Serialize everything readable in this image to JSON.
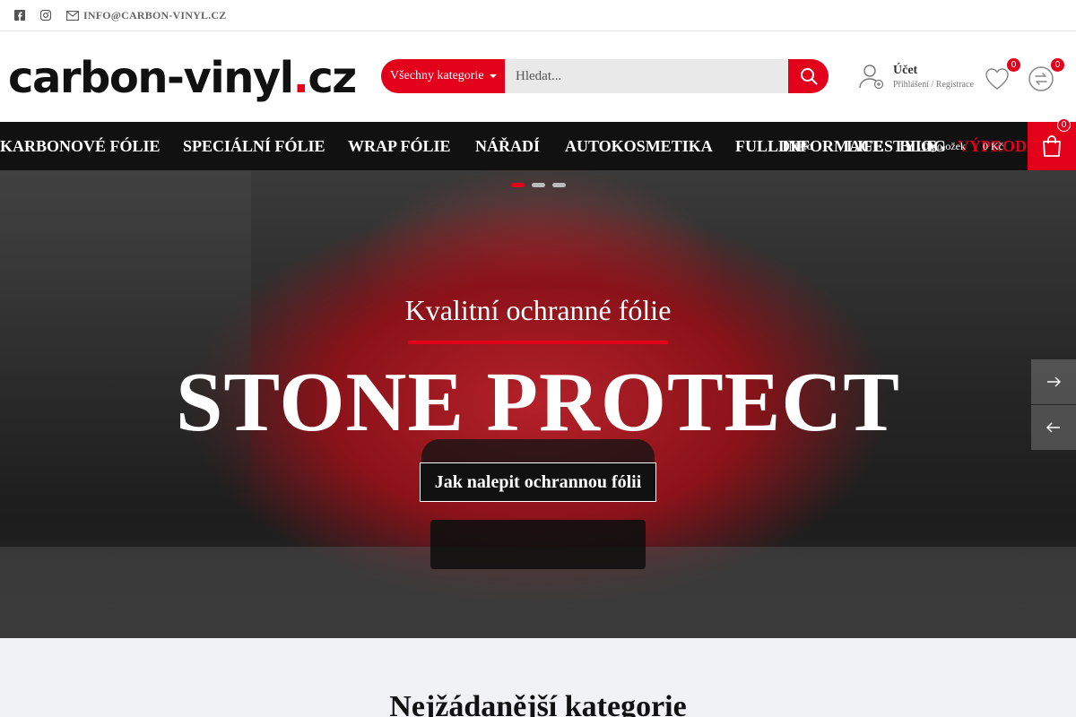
{
  "topbar": {
    "facebook_icon": "facebook-icon",
    "instagram_icon": "instagram-icon",
    "mail_icon": "mail-icon",
    "email": "INFO@CARBON-VINYL.CZ"
  },
  "header": {
    "logo_main": "carbon-vinyl",
    "logo_dot": ".",
    "logo_tld": "cz",
    "search": {
      "category_label": "Všechny kategorie",
      "placeholder": "Hledat..."
    },
    "account": {
      "title": "Účet",
      "subtitle": "Přihlášení / Registrace"
    },
    "wishlist_count": "0",
    "compare_count": "0"
  },
  "nav": {
    "items": [
      "KARBONOVÉ FÓLIE",
      "SPECIÁLNÍ FÓLIE",
      "WRAP FÓLIE",
      "NÁŘADÍ",
      "AUTOKOSMETIKA",
      "FULLDIP",
      "INFORMACE",
      "LIFESTYLE",
      "BLOG",
      "VÝPRODEJ"
    ],
    "overlay_texts": [
      "Info",
      "0 položek",
      "0 Kč"
    ],
    "cart_count": "0"
  },
  "hero": {
    "subtitle": "Kvalitní ochranné fólie",
    "title": "STONE PROTECT",
    "cta": "Jak nalepit ochrannou fólii",
    "slide_count": 3,
    "active_slide": 1
  },
  "section": {
    "title": "Nejžádanější kategorie"
  },
  "colors": {
    "accent": "#e3001b",
    "nav_bg": "#111111"
  }
}
